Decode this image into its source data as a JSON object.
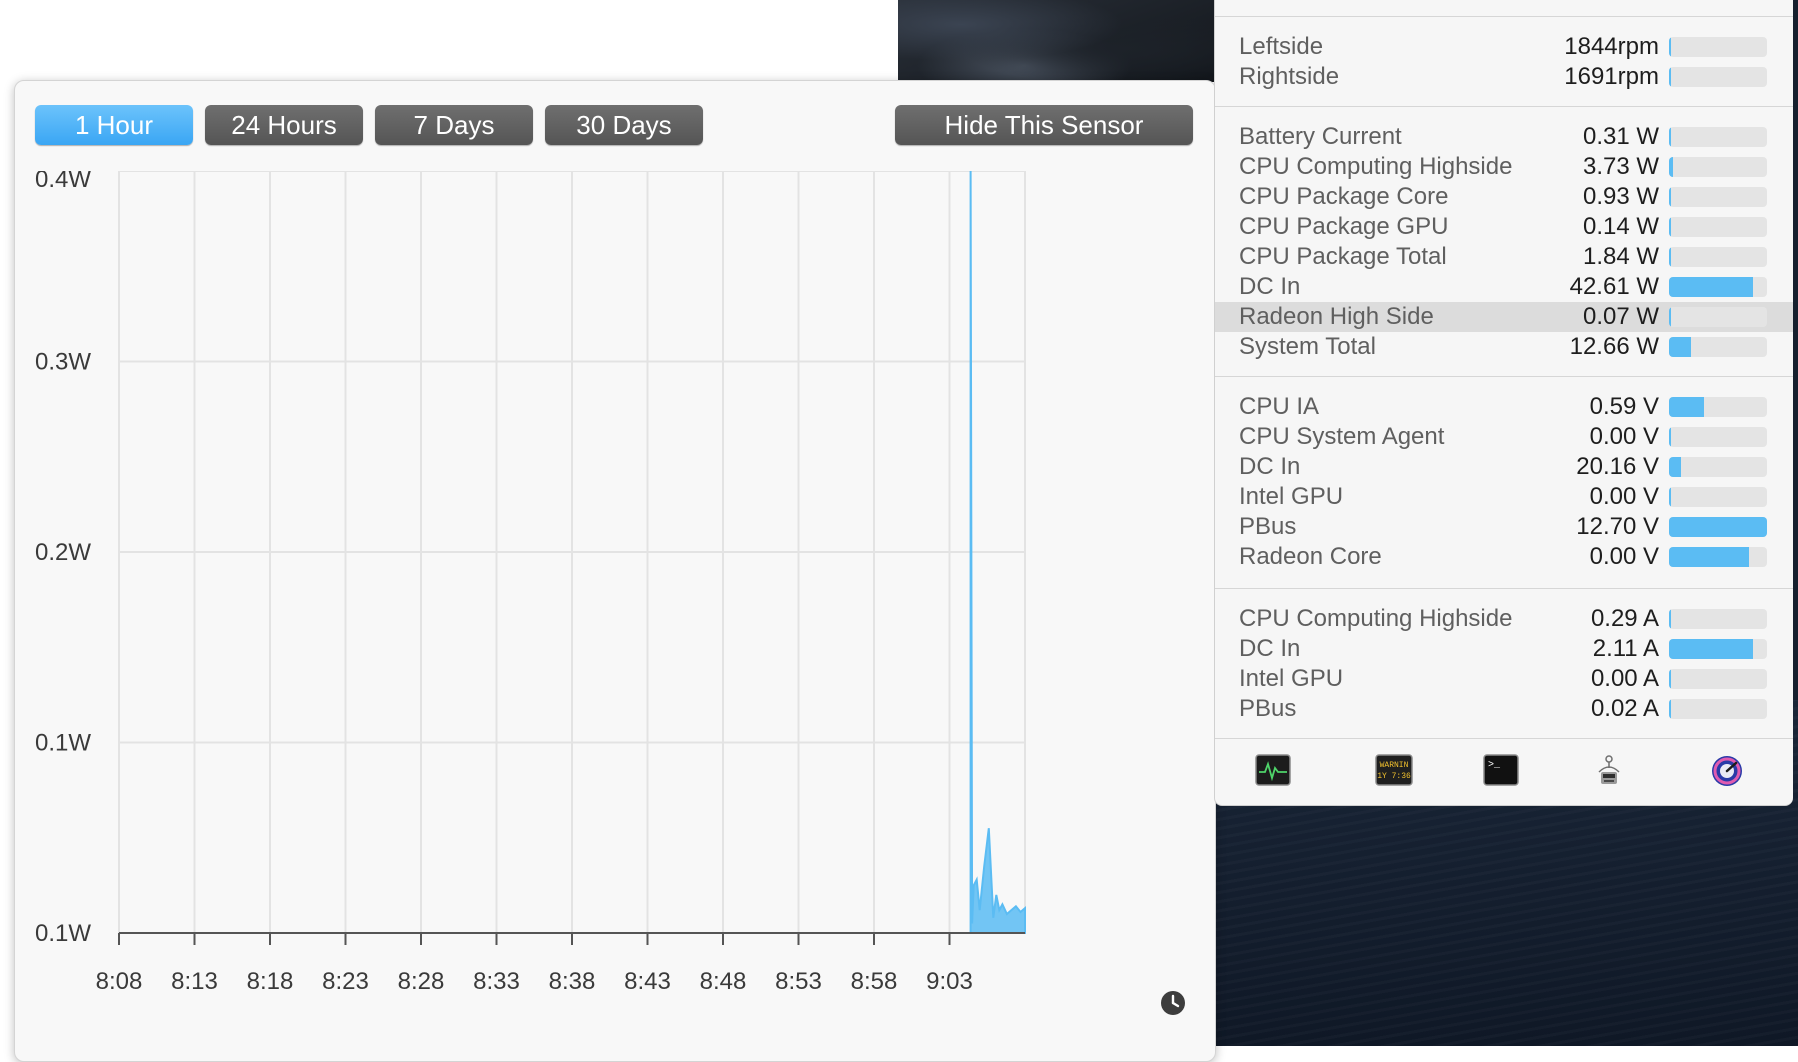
{
  "graph": {
    "buttons": [
      {
        "label": "1 Hour",
        "active": true
      },
      {
        "label": "24 Hours",
        "active": false
      },
      {
        "label": "7 Days",
        "active": false
      },
      {
        "label": "30 Days",
        "active": false
      }
    ],
    "hide_label": "Hide This Sensor",
    "y_ticks": [
      "0.4W",
      "0.3W",
      "0.2W",
      "0.1W",
      "0.1W"
    ],
    "x_ticks": [
      "8:08",
      "8:13",
      "8:18",
      "8:23",
      "8:28",
      "8:33",
      "8:38",
      "8:43",
      "8:48",
      "8:53",
      "8:58",
      "9:03"
    ],
    "clock_icon": "clock-icon"
  },
  "chart_data": {
    "type": "area",
    "title": "",
    "xlabel": "",
    "ylabel": "",
    "ylim": [
      0.0,
      0.4
    ],
    "color": "#5bbcf3",
    "x_minutes_after_8_08": [
      56.4,
      56.5,
      56.6,
      56.8,
      57.0,
      57.3,
      57.6,
      57.9,
      58.1,
      58.3,
      58.5,
      58.8,
      59.1,
      59.4,
      59.7,
      60.0
    ],
    "values": [
      0.4,
      0.005,
      0.025,
      0.028,
      0.012,
      0.035,
      0.055,
      0.008,
      0.02,
      0.012,
      0.015,
      0.01,
      0.012,
      0.014,
      0.011,
      0.013
    ]
  },
  "sensors": {
    "fans": [
      {
        "name": "Leftside",
        "value": "1844rpm",
        "fraction": 0.02
      },
      {
        "name": "Rightside",
        "value": "1691rpm",
        "fraction": 0.0
      }
    ],
    "power": [
      {
        "name": "Battery Current",
        "value": "0.31 W",
        "fraction": 0.02
      },
      {
        "name": "CPU Computing Highside",
        "value": "3.73 W",
        "fraction": 0.04
      },
      {
        "name": "CPU Package Core",
        "value": "0.93 W",
        "fraction": 0.02
      },
      {
        "name": "CPU Package GPU",
        "value": "0.14 W",
        "fraction": 0.01
      },
      {
        "name": "CPU Package Total",
        "value": "1.84 W",
        "fraction": 0.02
      },
      {
        "name": "DC In",
        "value": "42.61 W",
        "fraction": 0.86
      },
      {
        "name": "Radeon High Side",
        "value": "0.07 W",
        "fraction": 0.01,
        "highlighted": true
      },
      {
        "name": "System Total",
        "value": "12.66 W",
        "fraction": 0.22
      }
    ],
    "voltage": [
      {
        "name": "CPU IA",
        "value": "0.59 V",
        "fraction": 0.36
      },
      {
        "name": "CPU System Agent",
        "value": "0.00 V",
        "fraction": 0.0
      },
      {
        "name": "DC In",
        "value": "20.16 V",
        "fraction": 0.12
      },
      {
        "name": "Intel GPU",
        "value": "0.00 V",
        "fraction": 0.0
      },
      {
        "name": "PBus",
        "value": "12.70 V",
        "fraction": 1.0
      },
      {
        "name": "Radeon Core",
        "value": "0.00 V",
        "fraction": 0.82
      }
    ],
    "current": [
      {
        "name": "CPU Computing Highside",
        "value": "0.29 A",
        "fraction": 0.02
      },
      {
        "name": "DC In",
        "value": "2.11 A",
        "fraction": 0.86
      },
      {
        "name": "Intel GPU",
        "value": "0.00 A",
        "fraction": 0.0
      },
      {
        "name": "PBus",
        "value": "0.02 A",
        "fraction": 0.02
      }
    ]
  },
  "toolbar": {
    "icons": [
      "activity-monitor-icon",
      "console-icon",
      "terminal-icon",
      "system-info-icon",
      "disk-utility-icon"
    ],
    "console_text": [
      "WARNIN",
      "1Y 7:36"
    ],
    "terminal_text": ">_"
  }
}
